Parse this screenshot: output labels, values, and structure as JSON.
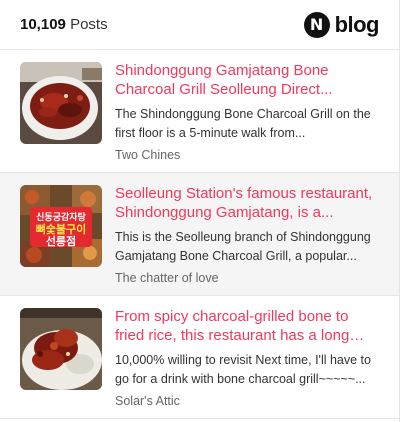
{
  "header": {
    "post_count": "10,109",
    "posts_label": "Posts",
    "brand_badge": "N",
    "brand_word": "blog"
  },
  "posts": [
    {
      "title": "Shindonggung Gamjatang Bone Charcoal Grill Seolleung Direct...",
      "snippet": "The Shindonggung Bone Charcoal Grill on the first floor is a 5-minute walk from...",
      "author": "Two Chines"
    },
    {
      "title": "Seolleung Station's famous restaurant, Shindonggung Gamjatang, is a...",
      "snippet": "This is the Seolleung branch of Shindonggung Gamjatang Bone Charcoal Grill, a popular...",
      "author": "The chatter of love",
      "thumb_text": [
        "신동궁감자탕",
        "뼈숯불구이",
        "선릉점"
      ]
    },
    {
      "title": "From spicy charcoal-grilled bone to fried rice, this restaurant has a long lin...",
      "snippet": "10,000% willing to revisit Next time, I'll have to go for a drink with bone charcoal grill~~~~~...",
      "author": "Solar's Attic"
    }
  ]
}
